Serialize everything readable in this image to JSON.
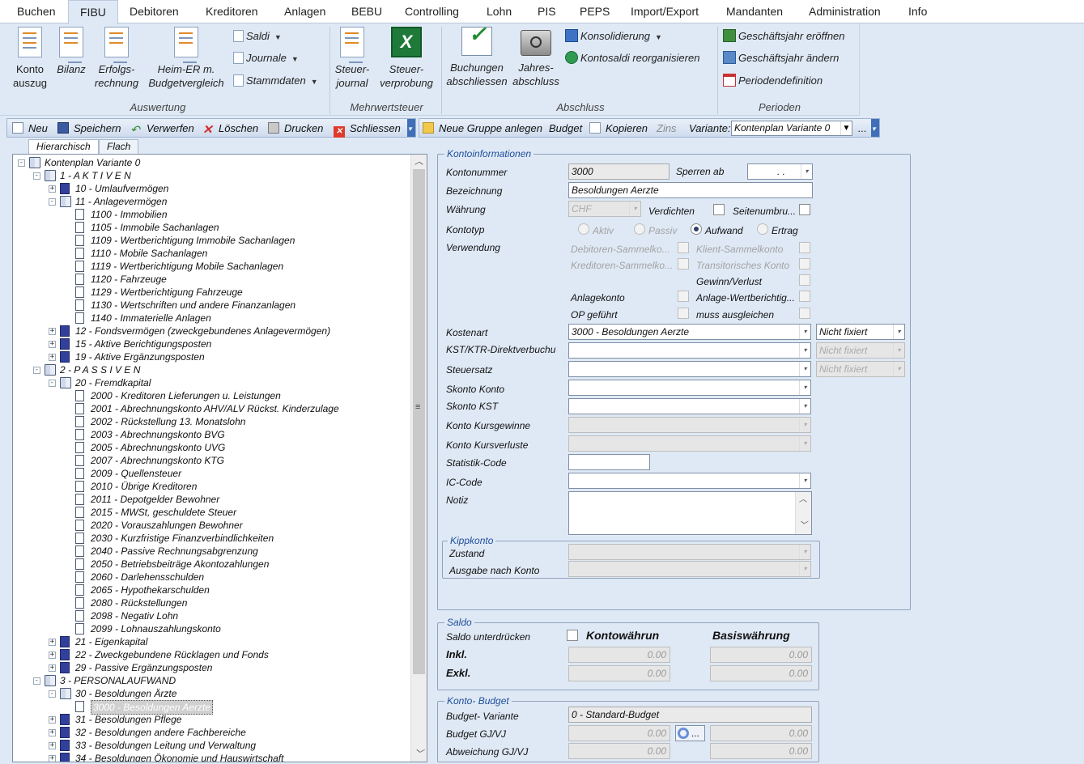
{
  "menu": {
    "tabs": [
      "Buchen",
      "FIBU",
      "Debitoren",
      "Kreditoren",
      "Anlagen",
      "BEBU",
      "Controlling",
      "Lohn",
      "PIS",
      "PEPS",
      "Import/Export",
      "Mandanten",
      "Administration",
      "Info"
    ],
    "active": "FIBU"
  },
  "ribbon": {
    "auswertung": {
      "title": "Auswertung",
      "konto_auszug": [
        "Konto",
        "auszug"
      ],
      "bilanz": "Bilanz",
      "erfolgsrechnung": [
        "Erfolgs-",
        "rechnung"
      ],
      "heim_er": [
        "Heim-ER m.",
        "Budgetvergleich"
      ],
      "saldi": "Saldi",
      "journale": "Journale",
      "stammdaten": "Stammdaten"
    },
    "mwst": {
      "title": "Mehrwertsteuer",
      "steuerjournal": [
        "Steuer-",
        "journal"
      ],
      "steuerverprobung": [
        "Steuer-",
        "verprobung"
      ]
    },
    "abschluss": {
      "title": "Abschluss",
      "buchungen": [
        "Buchungen",
        "abschliessen"
      ],
      "jahresabschluss": [
        "Jahres-",
        "abschluss"
      ],
      "konsolidierung": "Konsolidierung",
      "kontosaldi": "Kontosaldi reorganisieren"
    },
    "perioden": {
      "title": "Perioden",
      "gj_eroeffnen": "Geschäftsjahr eröffnen",
      "gj_aendern": "Geschäftsjahr ändern",
      "periodendefinition": "Periodendefinition"
    }
  },
  "toolbar": {
    "neu": "Neu",
    "speichern": "Speichern",
    "verwerfen": "Verwerfen",
    "loeschen": "Löschen",
    "drucken": "Drucken",
    "schliessen": "Schliessen",
    "neue_gruppe": "Neue Gruppe anlegen",
    "budget": "Budget",
    "kopieren": "Kopieren",
    "zins": "Zins",
    "variante_label": "Variante:",
    "variante_value": "Kontenplan Variante 0",
    "more": "..."
  },
  "tree": {
    "tabs": [
      "Hierarchisch",
      "Flach"
    ],
    "nodes": [
      {
        "label": "Kontenplan Variante 0",
        "level": 0,
        "icon": "book-icon",
        "exp": "-"
      },
      {
        "label": "1 - A K T I V E N",
        "level": 1,
        "icon": "book-icon",
        "exp": "-"
      },
      {
        "label": "10 - Umlaufvermögen",
        "level": 2,
        "icon": "folder-icon",
        "exp": "+"
      },
      {
        "label": "11 - Anlagevermögen",
        "level": 2,
        "icon": "book-icon",
        "exp": "-"
      },
      {
        "label": "1100 - Immobilien",
        "level": 3,
        "icon": "page-icon"
      },
      {
        "label": "1105 - Immobile Sachanlagen",
        "level": 3,
        "icon": "page-icon"
      },
      {
        "label": "1109 - Wertberichtigung Immobile Sachanlagen",
        "level": 3,
        "icon": "page-icon"
      },
      {
        "label": "1110 - Mobile Sachanlagen",
        "level": 3,
        "icon": "page-icon"
      },
      {
        "label": "1119 - Wertberichtigung Mobile Sachanlagen",
        "level": 3,
        "icon": "page-icon"
      },
      {
        "label": "1120 - Fahrzeuge",
        "level": 3,
        "icon": "page-icon"
      },
      {
        "label": "1129 - Wertberichtigung Fahrzeuge",
        "level": 3,
        "icon": "page-icon"
      },
      {
        "label": "1130 - Wertschriften und andere Finanzanlagen",
        "level": 3,
        "icon": "page-icon"
      },
      {
        "label": "1140 - Immaterielle Anlagen",
        "level": 3,
        "icon": "page-icon"
      },
      {
        "label": "12 - Fondsvermögen (zweckgebundenes Anlagevermögen)",
        "level": 2,
        "icon": "folder-icon",
        "exp": "+"
      },
      {
        "label": "15 - Aktive Berichtigungsposten",
        "level": 2,
        "icon": "folder-icon",
        "exp": "+"
      },
      {
        "label": "19 - Aktive Ergänzungsposten",
        "level": 2,
        "icon": "folder-icon",
        "exp": "+"
      },
      {
        "label": "2 - P A S S I V E N",
        "level": 1,
        "icon": "book-icon",
        "exp": "-"
      },
      {
        "label": "20 - Fremdkapital",
        "level": 2,
        "icon": "book-icon",
        "exp": "-"
      },
      {
        "label": "2000 - Kreditoren Lieferungen u. Leistungen",
        "level": 3,
        "icon": "page-icon"
      },
      {
        "label": "2001 - Abrechnungskonto AHV/ALV Rückst. Kinderzulage",
        "level": 3,
        "icon": "page-icon"
      },
      {
        "label": "2002 - Rückstellung 13. Monatslohn",
        "level": 3,
        "icon": "page-icon"
      },
      {
        "label": "2003 - Abrechnungskonto BVG",
        "level": 3,
        "icon": "page-icon"
      },
      {
        "label": "2005 - Abrechnungskonto UVG",
        "level": 3,
        "icon": "page-icon"
      },
      {
        "label": "2007 - Abrechnungskonto KTG",
        "level": 3,
        "icon": "page-icon"
      },
      {
        "label": "2009 - Quellensteuer",
        "level": 3,
        "icon": "page-icon"
      },
      {
        "label": "2010 - Übrige Kreditoren",
        "level": 3,
        "icon": "page-icon"
      },
      {
        "label": "2011 - Depotgelder Bewohner",
        "level": 3,
        "icon": "page-icon"
      },
      {
        "label": "2015 - MWSt, geschuldete Steuer",
        "level": 3,
        "icon": "page-icon"
      },
      {
        "label": "2020 - Vorauszahlungen Bewohner",
        "level": 3,
        "icon": "page-icon"
      },
      {
        "label": "2030 - Kurzfristige Finanzverbindlichkeiten",
        "level": 3,
        "icon": "page-icon"
      },
      {
        "label": "2040 - Passive Rechnungsabgrenzung",
        "level": 3,
        "icon": "page-icon"
      },
      {
        "label": "2050 - Betriebsbeiträge Akontozahlungen",
        "level": 3,
        "icon": "page-icon"
      },
      {
        "label": "2060 - Darlehensschulden",
        "level": 3,
        "icon": "page-icon"
      },
      {
        "label": "2065 - Hypothekarschulden",
        "level": 3,
        "icon": "page-icon"
      },
      {
        "label": "2080 - Rückstellungen",
        "level": 3,
        "icon": "page-icon"
      },
      {
        "label": "2098 - Negativ Lohn",
        "level": 3,
        "icon": "page-icon"
      },
      {
        "label": "2099 - Lohnauszahlungskonto",
        "level": 3,
        "icon": "page-icon"
      },
      {
        "label": "21 - Eigenkapital",
        "level": 2,
        "icon": "folder-icon",
        "exp": "+"
      },
      {
        "label": "22 - Zweckgebundene Rücklagen und Fonds",
        "level": 2,
        "icon": "folder-icon",
        "exp": "+"
      },
      {
        "label": "29 - Passive Ergänzungsposten",
        "level": 2,
        "icon": "folder-icon",
        "exp": "+"
      },
      {
        "label": "3 - PERSONALAUFWAND",
        "level": 1,
        "icon": "book-icon",
        "exp": "-"
      },
      {
        "label": "30 - Besoldungen Ärzte",
        "level": 2,
        "icon": "book-icon",
        "exp": "-"
      },
      {
        "label": "3000 - Besoldungen Aerzte",
        "level": 3,
        "icon": "page-icon",
        "selected": true
      },
      {
        "label": "31 - Besoldungen Pflege",
        "level": 2,
        "icon": "folder-icon",
        "exp": "+"
      },
      {
        "label": "32 - Besoldungen andere Fachbereiche",
        "level": 2,
        "icon": "folder-icon",
        "exp": "+"
      },
      {
        "label": "33 - Besoldungen Leitung und Verwaltung",
        "level": 2,
        "icon": "folder-icon",
        "exp": "+"
      },
      {
        "label": "34 - Besoldungen Ökonomie und Hauswirtschaft",
        "level": 2,
        "icon": "folder-icon",
        "exp": "+"
      }
    ]
  },
  "konto": {
    "legend": "Kontoinformationen",
    "kontonummer_label": "Kontonummer",
    "kontonummer": "3000",
    "sperren_label": "Sperren ab",
    "sperren_value": ". .",
    "bezeichnung_label": "Bezeichnung",
    "bezeichnung": "Besoldungen Aerzte",
    "waehrung_label": "Währung",
    "waehrung": "CHF",
    "verdichten_label": "Verdichten",
    "seitenumbruch_label": "Seitenumbru...",
    "kontotyp_label": "Kontotyp",
    "kontotyp_options": [
      "Aktiv",
      "Passiv",
      "Aufwand",
      "Ertrag"
    ],
    "kontotyp_selected": "Aufwand",
    "verwendung_label": "Verwendung",
    "debitoren_sammel": "Debitoren-Sammelko...",
    "kreditoren_sammel": "Kreditoren-Sammelko...",
    "klient_sammel": "Klient-Sammelkonto",
    "transitorisch": "Transitorisches Konto",
    "gewinn_verlust": "Gewinn/Verlust",
    "anlagekonto": "Anlagekonto",
    "anlage_wertber": "Anlage-Wertberichtig...",
    "op_gefuehrt": "OP geführt",
    "muss_ausgleichen": "muss ausgleichen",
    "kostenart_label": "Kostenart",
    "kostenart": "3000 - Besoldungen Aerzte",
    "kostenart_fix": "Nicht fixiert",
    "kst_label": "KST/KTR-Direktverbuchu",
    "kst_fix": "Nicht fixiert",
    "steuersatz_label": "Steuersatz",
    "steuersatz_fix": "Nicht fixiert",
    "skonto_konto_label": "Skonto Konto",
    "skonto_kst_label": "Skonto KST",
    "kursgewinne_label": "Konto Kursgewinne",
    "kursverluste_label": "Konto Kursverluste",
    "statistik_label": "Statistik-Code",
    "ic_label": "IC-Code",
    "notiz_label": "Notiz",
    "kippkonto_legend": "Kippkonto",
    "zustand_label": "Zustand",
    "ausgabe_label": "Ausgabe nach Konto"
  },
  "saldo": {
    "legend": "Saldo",
    "unterdruecken_label": "Saldo unterdrücken",
    "kontowaehrung": "Kontowährun",
    "basiswaehrung": "Basiswährung",
    "inkl_label": "Inkl.",
    "exkl_label": "Exkl.",
    "inkl_konto": "0.00",
    "inkl_basis": "0.00",
    "exkl_konto": "0.00",
    "exkl_basis": "0.00"
  },
  "budget": {
    "legend": "Konto- Budget",
    "variante_label": "Budget- Variante",
    "variante": "0  - Standard-Budget",
    "gjvj_label": "Budget GJ/VJ",
    "gj": "0.00",
    "vj": "0.00",
    "abw_label": "Abweichung GJ/VJ",
    "abw_gj": "0.00",
    "abw_vj": "0.00",
    "more": "..."
  },
  "colors": {
    "ribbon_bg": "#dfe9f5",
    "accent": "#1f4e9a",
    "tree_folder": "#32409b"
  }
}
